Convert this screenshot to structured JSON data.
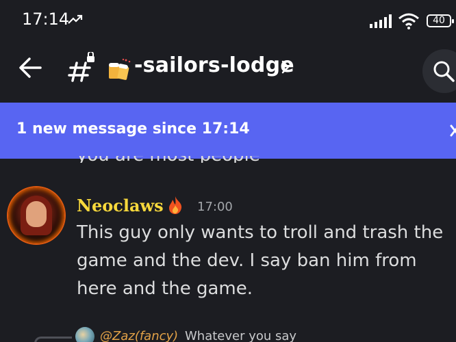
{
  "status_bar": {
    "time": "17:14",
    "battery": "40"
  },
  "header": {
    "channel_name": "-sailors-lodge"
  },
  "banner": {
    "text": "1 new message since 17:14"
  },
  "previous_message": {
    "text": "you are most people"
  },
  "message": {
    "username": "Neoclaws",
    "timestamp": "17:00",
    "body": "This guy only wants to troll and trash the game and the dev. I say ban him from here and the game."
  },
  "reply": {
    "username": "@Zaz(fancy)",
    "text": "Whatever you say"
  },
  "colors": {
    "background": "#1c1d22",
    "banner": "#5865f2",
    "username": "#f7d83c"
  }
}
